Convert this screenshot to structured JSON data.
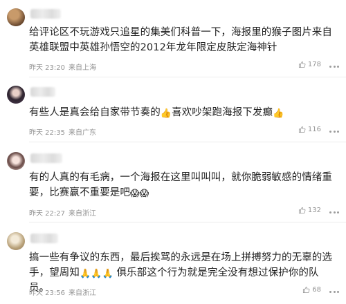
{
  "comments": [
    {
      "text": "给评论区不玩游戏只追星的集美们科普一下，海报里的猴子图片来自英雄联盟中英雄孙悟空的2012年龙年限定皮肤定海神针",
      "time": "昨天 23:20",
      "location": "来自上海",
      "likes": "178",
      "avatar_color": "#7a5a3a"
    },
    {
      "text_a": "有些人是真会给自家带节奏的",
      "emoji_a": "👍",
      "text_b": "喜欢吵架跑海报下发癫",
      "emoji_b": "👍",
      "time": "昨天 22:35",
      "location": "来自广东",
      "likes": "116",
      "avatar_color": "#3b2f3f"
    },
    {
      "text": "有的人真的有毛病，一个海报在这里叫叫叫，就你脆弱敏感的情绪重要，比赛赢不重要是吧",
      "emoji": "😱😱",
      "time": "昨天 22:27",
      "location": "来自浙江",
      "likes": "132",
      "avatar_color": "#d8c8c8"
    },
    {
      "text_a": "搞一些有争议的东西，最后挨骂的永远是在场上拼搏努力的无辜的选手，望周知",
      "emoji": "🙏🙏🙏",
      "text_b": " 俱乐部这个行为就是完全没有想过保护你的队员。",
      "time": "昨天 23:56",
      "location": "来自浙江",
      "likes": "68",
      "avatar_color": "#c9b79a"
    }
  ],
  "icons": {
    "like": "thumbs-up-outline-icon",
    "more": "more-dots-icon"
  }
}
